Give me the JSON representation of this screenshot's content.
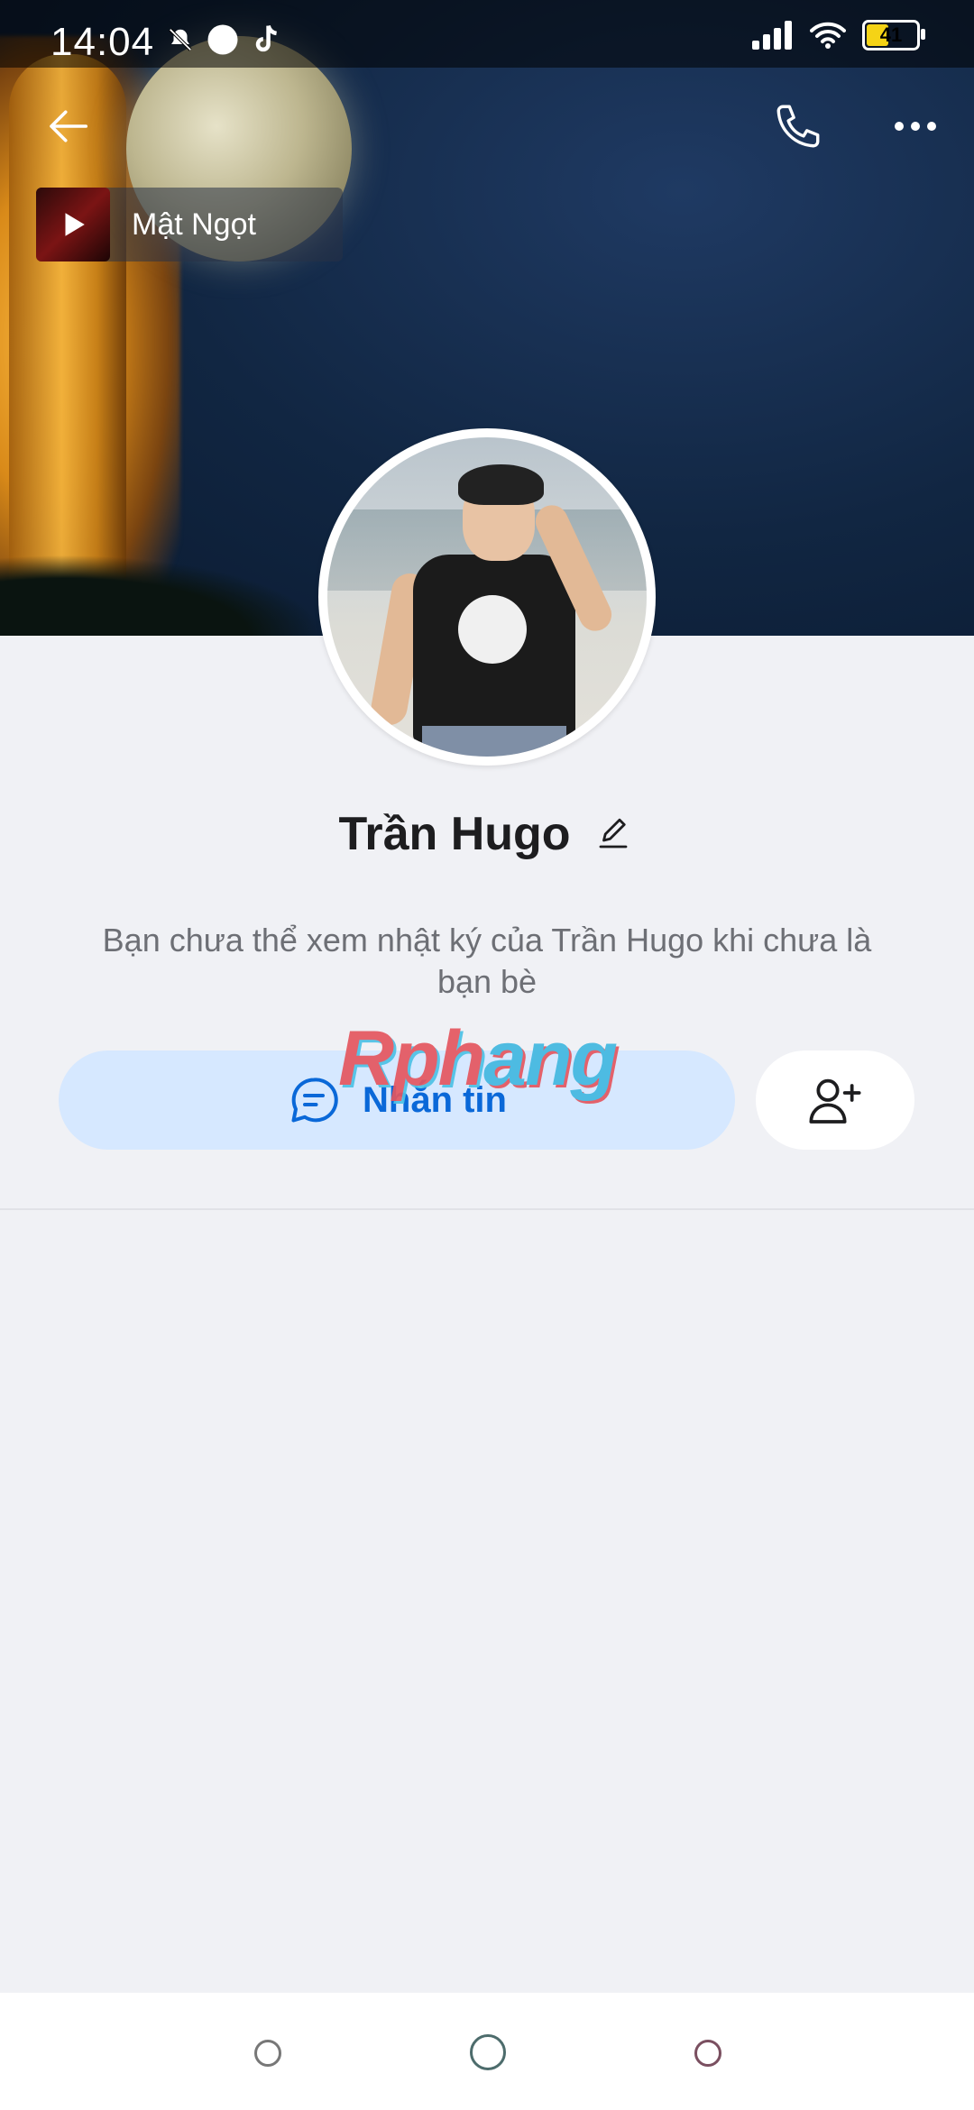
{
  "status_bar": {
    "time": "14:04",
    "battery_level": "41",
    "icons": [
      "silent-icon",
      "dot-icon",
      "tiktok-icon",
      "signal-icon",
      "wifi-icon",
      "battery-icon"
    ]
  },
  "header": {
    "back_icon": "arrow-left-icon",
    "call_icon": "phone-icon",
    "more_icon": "more-dots-icon"
  },
  "music": {
    "title": "Mật Ngọt"
  },
  "profile": {
    "name": "Trần Hugo",
    "notice": "Bạn chưa thể xem nhật ký của Trần Hugo khi chưa là bạn bè"
  },
  "actions": {
    "message_label": "Nhắn tin",
    "add_friend_icon": "add-friend-icon"
  },
  "watermark": {
    "part1": "Rph",
    "part2": "ang"
  },
  "colors": {
    "accent": "#0a68d8",
    "button_bg": "#d6e8ff",
    "page_bg": "#f0f1f5"
  }
}
